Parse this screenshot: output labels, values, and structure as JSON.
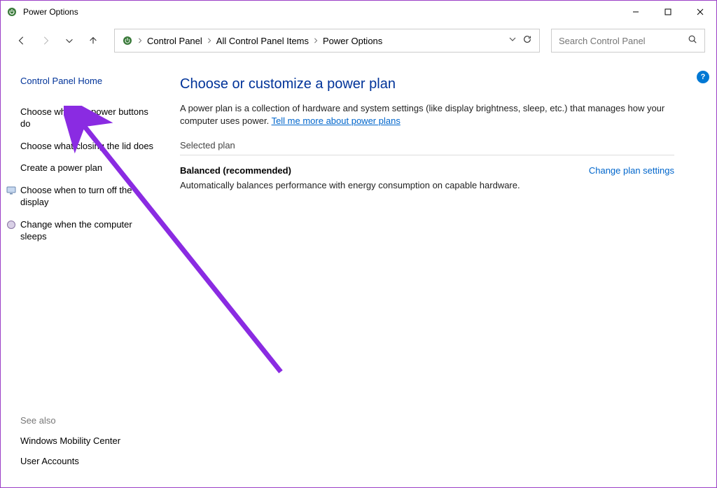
{
  "window": {
    "title": "Power Options"
  },
  "address": {
    "crumbs": [
      "Control Panel",
      "All Control Panel Items",
      "Power Options"
    ]
  },
  "search": {
    "placeholder": "Search Control Panel"
  },
  "sidebar": {
    "home": "Control Panel Home",
    "links": [
      "Choose what the power buttons do",
      "Choose what closing the lid does",
      "Create a power plan"
    ],
    "iconLinks": [
      "Choose when to turn off the display",
      "Change when the computer sleeps"
    ]
  },
  "sideFooter": {
    "heading": "See also",
    "links": [
      "Windows Mobility Center",
      "User Accounts"
    ]
  },
  "main": {
    "heading": "Choose or customize a power plan",
    "descPrefix": "A power plan is a collection of hardware and system settings (like display brightness, sleep, etc.) that manages how your computer uses power. ",
    "descLink": "Tell me more about power plans",
    "sectionLabel": "Selected plan",
    "planName": "Balanced (recommended)",
    "planChange": "Change plan settings",
    "planDesc": "Automatically balances performance with energy consumption on capable hardware."
  },
  "help": "?"
}
